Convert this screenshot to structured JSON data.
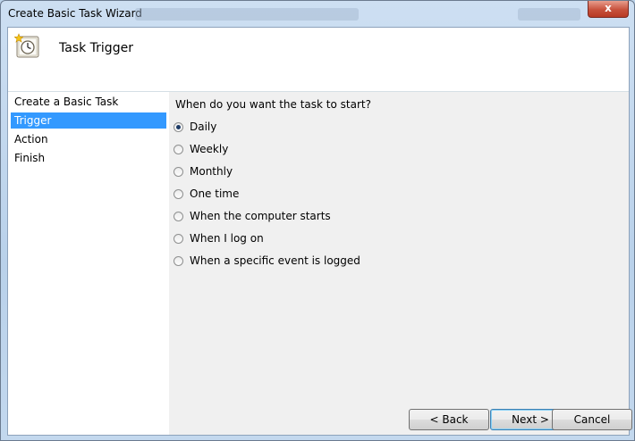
{
  "window": {
    "title": "Create Basic Task Wizard",
    "close_label": "x"
  },
  "header": {
    "title": "Task Trigger",
    "icon": "task-clock-icon"
  },
  "steps": [
    {
      "label": "Create a Basic Task",
      "active": false
    },
    {
      "label": "Trigger",
      "active": true
    },
    {
      "label": "Action",
      "active": false
    },
    {
      "label": "Finish",
      "active": false
    }
  ],
  "main": {
    "question": "When do you want the task to start?",
    "options": [
      {
        "label": "Daily",
        "selected": true
      },
      {
        "label": "Weekly",
        "selected": false
      },
      {
        "label": "Monthly",
        "selected": false
      },
      {
        "label": "One time",
        "selected": false
      },
      {
        "label": "When the computer starts",
        "selected": false
      },
      {
        "label": "When I log on",
        "selected": false
      },
      {
        "label": "When a specific event is logged",
        "selected": false
      }
    ]
  },
  "buttons": {
    "back": "< Back",
    "next": "Next >",
    "cancel": "Cancel"
  },
  "colors": {
    "selection": "#3399ff",
    "client_background": "#f0f0f0",
    "close_button": "#c7513c"
  }
}
